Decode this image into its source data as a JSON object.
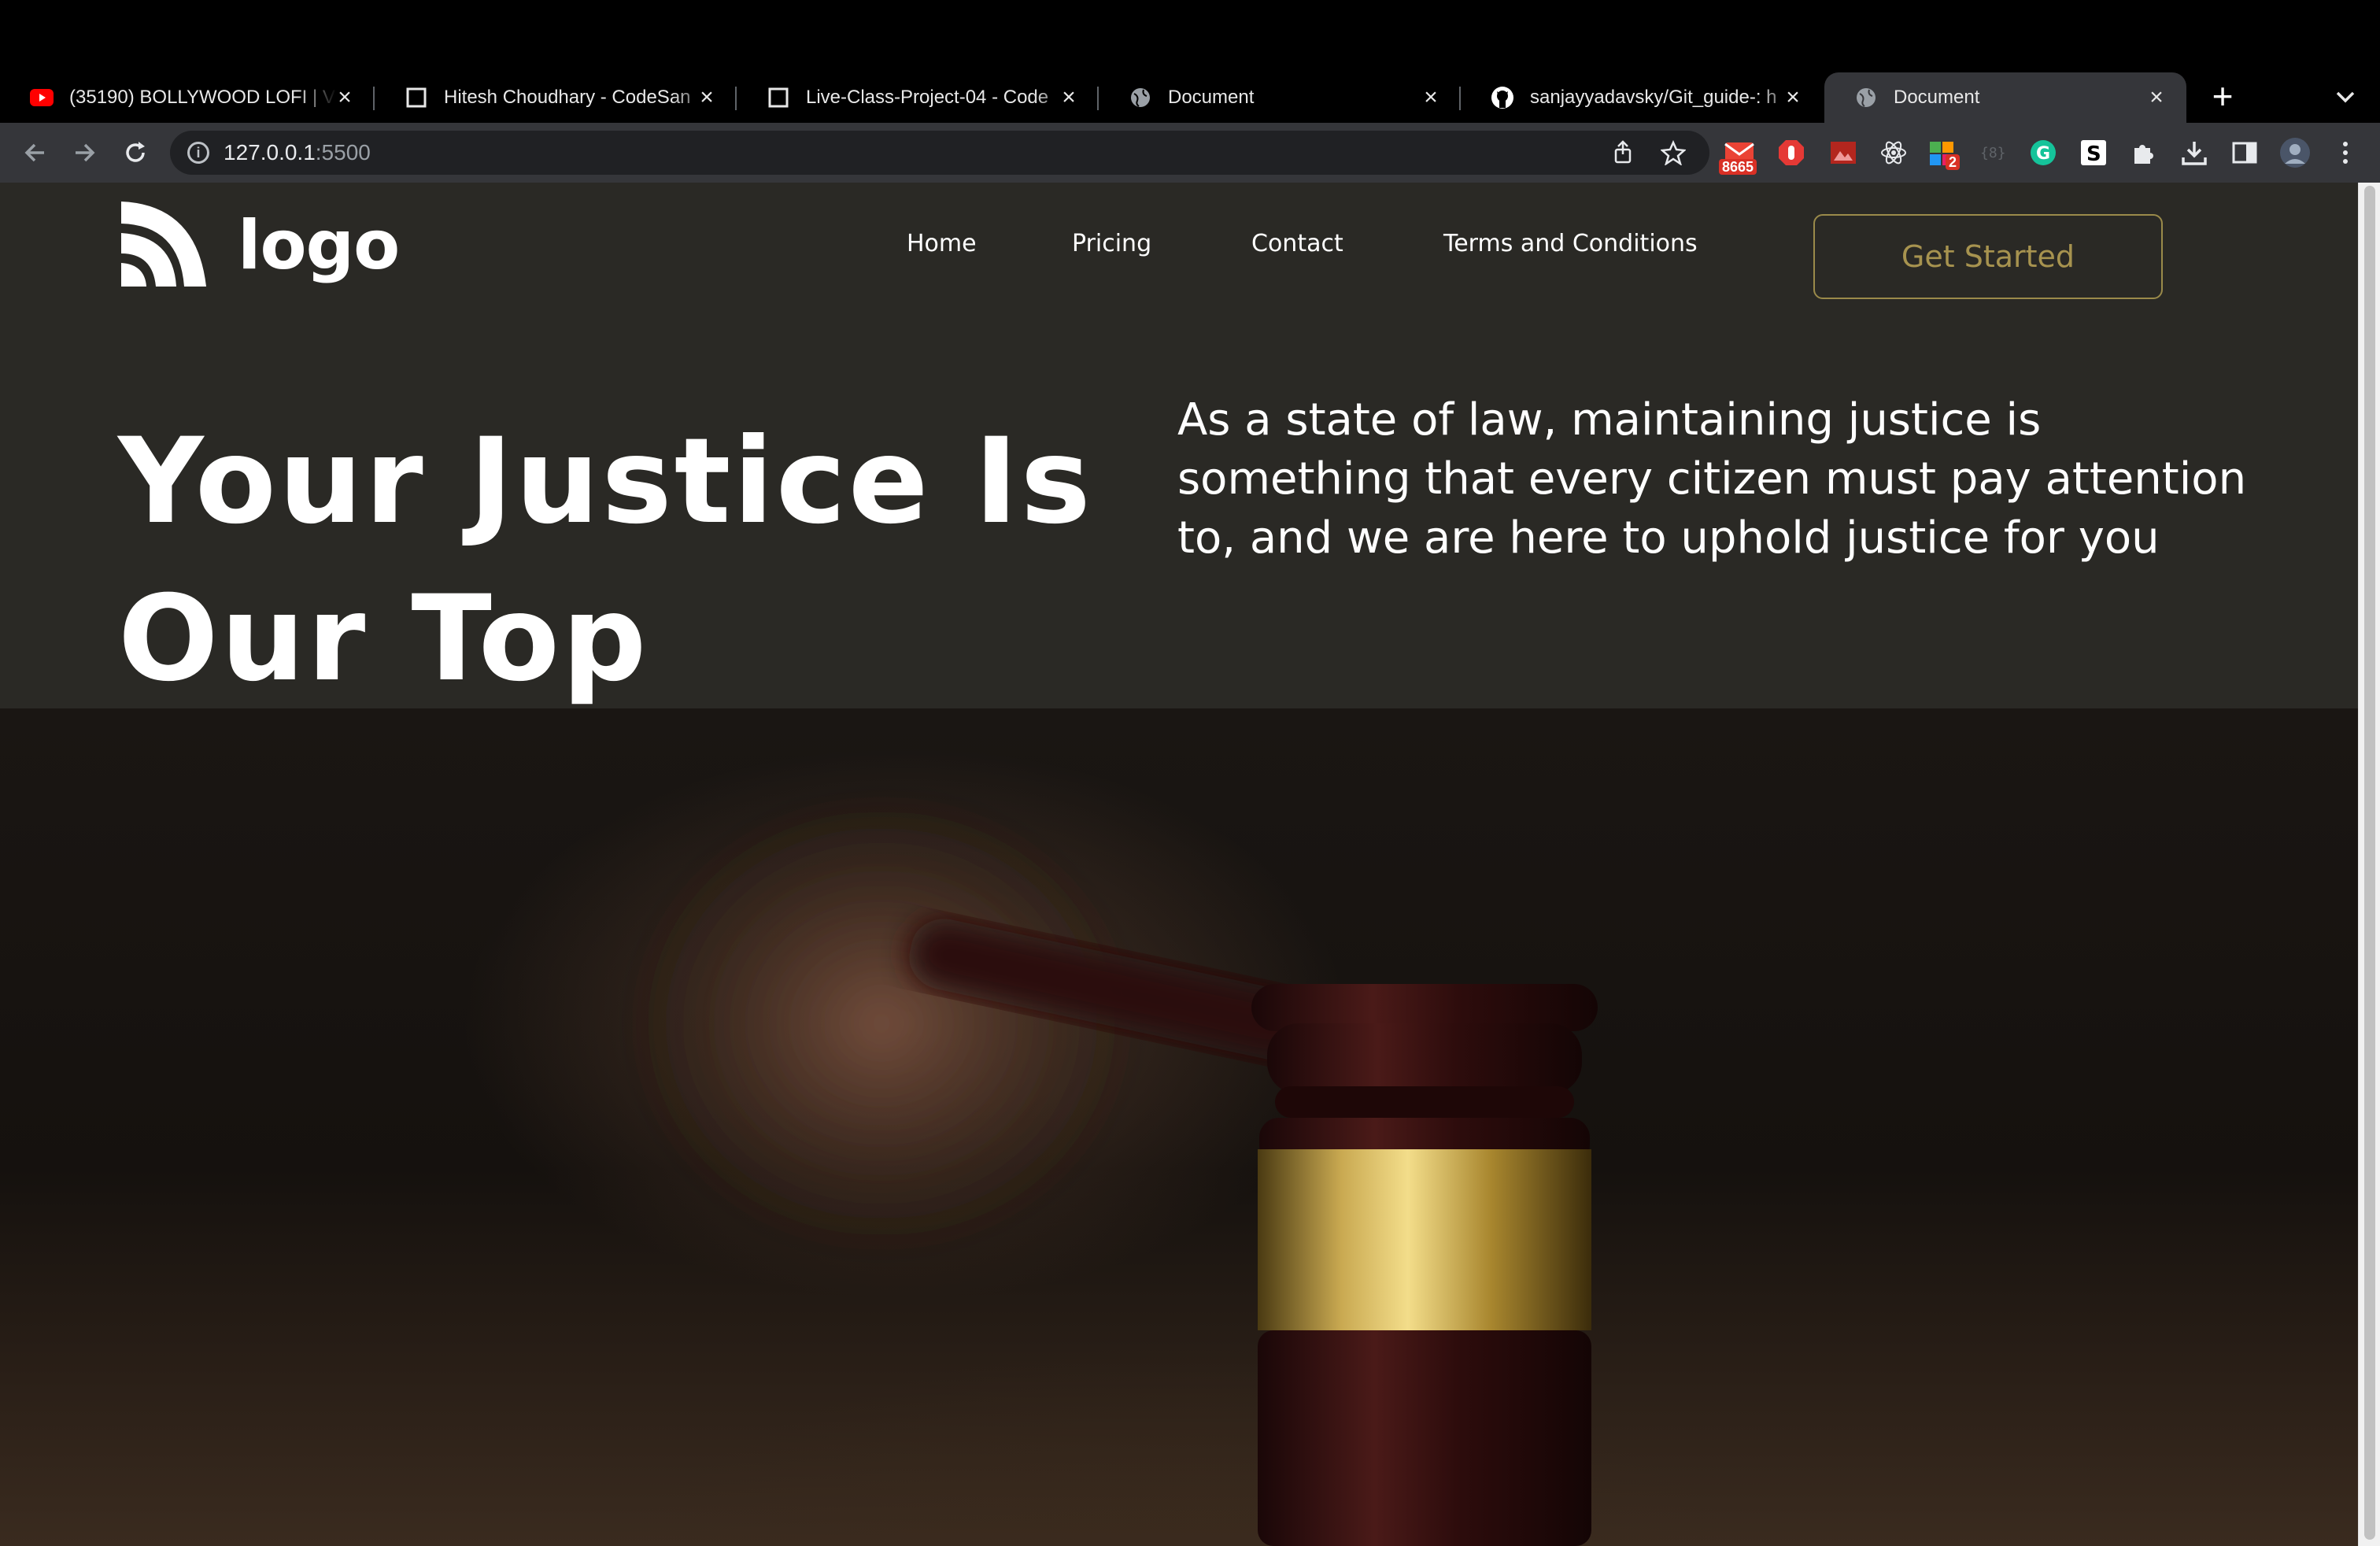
{
  "browser": {
    "tabs": [
      {
        "title": "(35190) BOLLYWOOD LOFI | V",
        "icon": "youtube-icon",
        "active": false
      },
      {
        "title": "Hitesh Choudhary - CodeSan",
        "icon": "page-icon",
        "active": false
      },
      {
        "title": "Live-Class-Project-04 - Code",
        "icon": "page-icon",
        "active": false
      },
      {
        "title": "Document",
        "icon": "globe-icon",
        "active": false
      },
      {
        "title": "sanjayyadavsky/Git_guide-: h",
        "icon": "github-icon",
        "active": false
      },
      {
        "title": "Document",
        "icon": "globe-icon",
        "active": true
      }
    ],
    "new_tab_label": "+",
    "close_label": "×",
    "url_host": "127.0.0.1",
    "url_port": ":5500",
    "extensions": [
      "gmail-icon",
      "adblock-icon",
      "image-icon",
      "react-icon",
      "ext-icon",
      "bracket-icon",
      "grammarly-icon",
      "s-icon",
      "puzzle-icon",
      "download-icon",
      "sidepanel-icon",
      "profile-avatar",
      "menu-icon"
    ],
    "gmail_badge": "8665",
    "ext_badge": "2",
    "colors": {
      "tabstrip": "#000000",
      "toolbar": "#35363a",
      "omnibox": "#202124"
    }
  },
  "site": {
    "logo_text": "logo",
    "nav": {
      "home": "Home",
      "pricing": "Pricing",
      "contact": "Contact",
      "terms": "Terms and Conditions"
    },
    "cta_label": "Get Started",
    "hero_title_line1": "Your Justice Is",
    "hero_title_line2": "Our Top Priority",
    "hero_description": "As a state of law, maintaining justice is something that every citizen must pay attention to, and we are here to uphold justice for you",
    "colors": {
      "background": "#2a2925",
      "accent": "#a7934f",
      "text": "#ffffff"
    }
  }
}
